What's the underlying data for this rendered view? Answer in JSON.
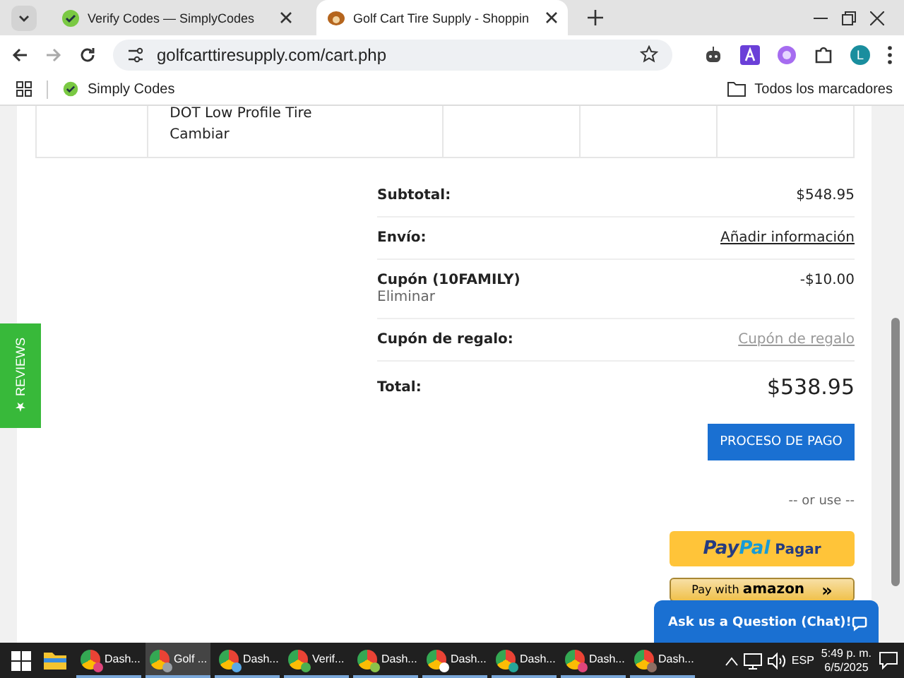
{
  "browser": {
    "tabs": [
      {
        "title": "Verify Codes — SimplyCodes",
        "selected": false,
        "kind": "check"
      },
      {
        "title": "Golf Cart Tire Supply - Shoppin",
        "selected": true,
        "kind": "tire"
      }
    ],
    "url": "golfcarttiresupply.com/cart.php",
    "bookmarks": [
      {
        "label": "Simply Codes"
      }
    ],
    "all_bookmarks": "Todos los marcadores",
    "profile_initial": "L"
  },
  "review_tab": "★ REVIEWS",
  "cart_row": {
    "lines": [
      "DOT Low Profile Tire",
      "Cambiar"
    ]
  },
  "summary": [
    {
      "label": "Subtotal:",
      "value": "$548.95",
      "kind": "plain"
    },
    {
      "label": "Envío:",
      "value": "Añadir información",
      "kind": "link"
    },
    {
      "label": "Cupón (10FAMILY)",
      "sub": "Eliminar",
      "value": "-$10.00",
      "kind": "coupon"
    },
    {
      "label": "Cupón de regalo:",
      "value": "Cupón de regalo",
      "kind": "muted-link"
    },
    {
      "label": "Total:",
      "value": "$538.95",
      "kind": "total"
    }
  ],
  "checkout_button": "PROCESO DE PAGO",
  "or_use": "-- or use --",
  "paypal": {
    "logo_a": "Pay",
    "logo_b": "Pal",
    "label": "Pagar"
  },
  "amazon": {
    "label": "Pay with",
    "brand": "amazon",
    "arrows": "»"
  },
  "chat": {
    "label": "Ask us a Question (Chat)!"
  },
  "taskbar": {
    "items": [
      {
        "label": "Dash...",
        "selected": false,
        "color": "#e0457b"
      },
      {
        "label": "Golf ...",
        "selected": true,
        "color": "#9aa0a6"
      },
      {
        "label": "Dash...",
        "selected": false,
        "color": "#5aa9e6"
      },
      {
        "label": "Verif...",
        "selected": false,
        "color": "#4caf50"
      },
      {
        "label": "Dash...",
        "selected": false,
        "color": "#8bc34a"
      },
      {
        "label": "Dash...",
        "selected": false,
        "color": "#ffffff"
      },
      {
        "label": "Dash...",
        "selected": false,
        "color": "#26a69a"
      },
      {
        "label": "Dash...",
        "selected": false,
        "color": "#e0457b"
      },
      {
        "label": "Dash...",
        "selected": false,
        "color": "#8d6e63"
      }
    ],
    "language": "ESP",
    "time": "5:49 p. m.",
    "date": "6/5/2025"
  }
}
